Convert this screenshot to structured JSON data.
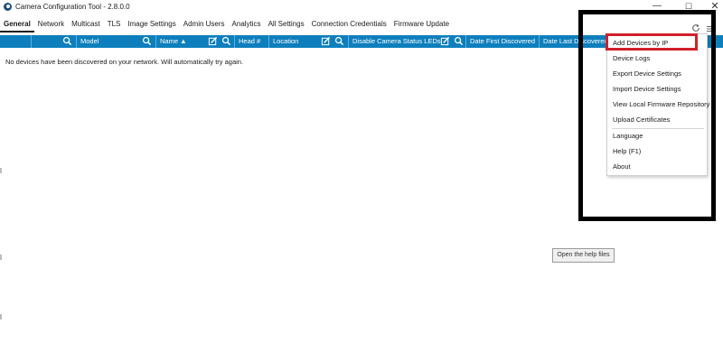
{
  "window": {
    "title": "Camera Configuration Tool - 2.8.0.0",
    "minimize": "—",
    "maximize": "☐",
    "close": "✕"
  },
  "tabs": [
    {
      "label": "General",
      "active": true
    },
    {
      "label": "Network"
    },
    {
      "label": "Multicast"
    },
    {
      "label": "TLS"
    },
    {
      "label": "Image Settings"
    },
    {
      "label": "Admin Users"
    },
    {
      "label": "Analytics"
    },
    {
      "label": "All Settings"
    },
    {
      "label": "Connection Credentials"
    },
    {
      "label": "Firmware Update"
    }
  ],
  "columns": {
    "model": "Model",
    "name": "Name ▲",
    "head": "Head #",
    "location": "Location",
    "disable_leds": "Disable Camera Status LEDs",
    "date_first": "Date First Discovered",
    "date_last": "Date Last Discovered"
  },
  "main": {
    "empty_message": "No devices have been discovered on your network. Will automatically try again.",
    "help_button": "Open the help files"
  },
  "menu": {
    "items": [
      "Add Devices by IP",
      "Device Logs",
      "Export Device Settings",
      "Import Device Settings",
      "View Local Firmware Repository",
      "Upload Certificates",
      "Language",
      "Help (F1)",
      "About"
    ]
  },
  "colors": {
    "header_bg": "#0e7fbd",
    "annotation_red": "#d0202a",
    "annotation_black": "#000000"
  }
}
